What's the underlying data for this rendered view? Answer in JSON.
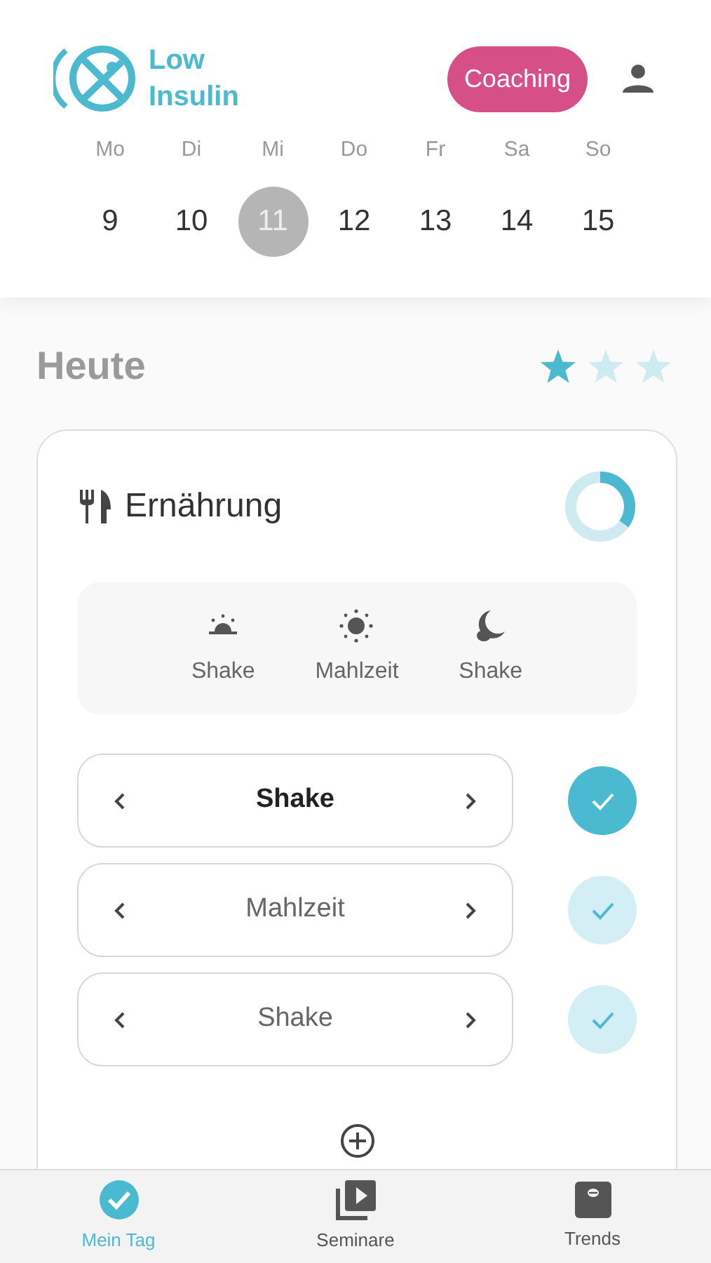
{
  "header": {
    "logo_text": [
      "Low",
      "Insulin"
    ],
    "coaching_button": "Coaching"
  },
  "week": [
    {
      "weekday": "Mo",
      "date": "9",
      "selected": false
    },
    {
      "weekday": "Di",
      "date": "10",
      "selected": false
    },
    {
      "weekday": "Mi",
      "date": "11",
      "selected": true
    },
    {
      "weekday": "Do",
      "date": "12",
      "selected": false
    },
    {
      "weekday": "Fr",
      "date": "13",
      "selected": false
    },
    {
      "weekday": "Sa",
      "date": "14",
      "selected": false
    },
    {
      "weekday": "So",
      "date": "15",
      "selected": false
    }
  ],
  "today": {
    "title": "Heute",
    "stars": 1
  },
  "nutrition_card": {
    "title": "Ernährung",
    "progress": {
      "level": 0.35
    },
    "meal_times": [
      {
        "kind": "sunrise",
        "label": "Shake"
      },
      {
        "kind": "sun",
        "label": "Mahlzeit"
      },
      {
        "kind": "moon",
        "label": "Shake"
      }
    ],
    "meals": [
      {
        "label": "Shake",
        "selected": true,
        "checked": true
      },
      {
        "label": "Mahlzeit",
        "selected": false,
        "checked": false
      },
      {
        "label": "Shake",
        "selected": false,
        "checked": false
      }
    ]
  },
  "bottom_nav": [
    {
      "kind": "check",
      "label": "Mein Tag",
      "selected": true
    },
    {
      "kind": "video",
      "label": "Seminare",
      "selected": false
    },
    {
      "kind": "scale",
      "label": "Trends",
      "selected": false
    }
  ]
}
